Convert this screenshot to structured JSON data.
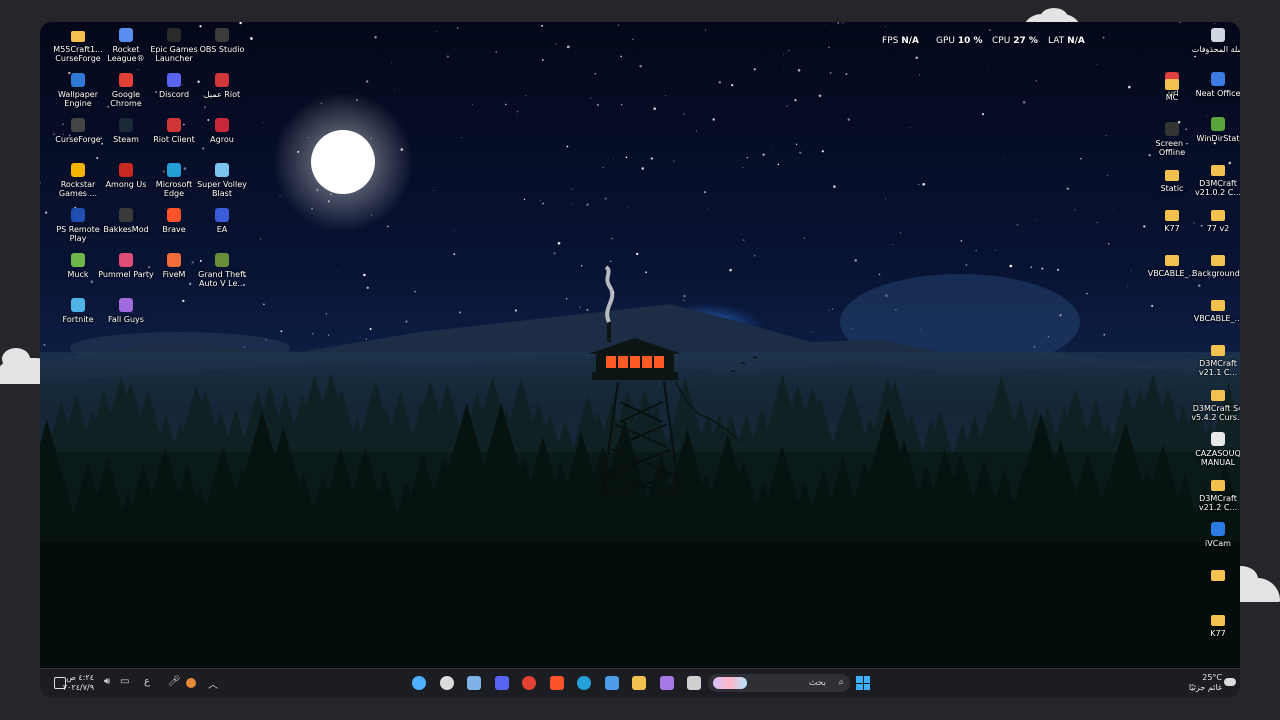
{
  "hud": {
    "fps_label": "FPS",
    "fps_value": "N/A",
    "gpu_label": "GPU",
    "gpu_value": "10 %",
    "cpu_label": "CPU",
    "cpu_value": "27 %",
    "lat_label": "LAT",
    "lat_value": "N/A"
  },
  "desktop": {
    "left_icons": [
      {
        "label": "M55Craft1... CurseForge",
        "icon": "folder-icon",
        "color": "#f2c14e"
      },
      {
        "label": "Rocket League®",
        "icon": "rocket-league-icon",
        "color": "#5b8df0"
      },
      {
        "label": "Epic Games Launcher",
        "icon": "epic-games-icon",
        "color": "#2a2a2a"
      },
      {
        "label": "OBS Studio",
        "icon": "obs-icon",
        "color": "#3b3b3b"
      },
      {
        "label": "Wallpaper Engine",
        "icon": "wallpaper-engine-icon",
        "color": "#2f79d6"
      },
      {
        "label": "Google Chrome",
        "icon": "chrome-icon",
        "color": "#e34133"
      },
      {
        "label": "Discord",
        "icon": "discord-icon",
        "color": "#5865f2"
      },
      {
        "label": "عميل Riot",
        "icon": "riot-icon",
        "color": "#d13639"
      },
      {
        "label": "CurseForge",
        "icon": "curseforge-icon",
        "color": "#444"
      },
      {
        "label": "Steam",
        "icon": "steam-icon",
        "color": "#1b2838"
      },
      {
        "label": "Riot Client",
        "icon": "riot-client-icon",
        "color": "#d13639"
      },
      {
        "label": "Agrou",
        "icon": "agrou-icon",
        "color": "#c8283c"
      },
      {
        "label": "Rockstar Games ...",
        "icon": "rockstar-icon",
        "color": "#f5b400"
      },
      {
        "label": "Among Us",
        "icon": "among-us-icon",
        "color": "#c8281e"
      },
      {
        "label": "Microsoft Edge",
        "icon": "edge-icon",
        "color": "#23a1d6"
      },
      {
        "label": "Super Volley Blast",
        "icon": "super-volley-icon",
        "color": "#7bc4f0"
      },
      {
        "label": "PS Remote Play",
        "icon": "ps-remote-icon",
        "color": "#1f4fb0"
      },
      {
        "label": "BakkesMod",
        "icon": "bakkesmod-icon",
        "color": "#3a3a3a"
      },
      {
        "label": "Brave",
        "icon": "brave-icon",
        "color": "#fb542b"
      },
      {
        "label": "EA",
        "icon": "ea-icon",
        "color": "#3b5bd9"
      },
      {
        "label": "Muck",
        "icon": "muck-icon",
        "color": "#6fb84a"
      },
      {
        "label": "Pummel Party",
        "icon": "pummel-party-icon",
        "color": "#e04d74"
      },
      {
        "label": "FiveM",
        "icon": "fivem-icon",
        "color": "#f26b3a"
      },
      {
        "label": "Grand Theft Auto V Le...",
        "icon": "gta-icon",
        "color": "#6a8f3a"
      },
      {
        "label": "Fortnite",
        "icon": "fortnite-icon",
        "color": "#4fb3e8"
      },
      {
        "label": "Fall Guys",
        "icon": "fall-guys-icon",
        "color": "#a16be0"
      }
    ],
    "right_icons": [
      {
        "label": "سلة المحذوفات",
        "icon": "recycle-bin-icon",
        "color": "#cfd8e0"
      },
      {
        "label": ".url",
        "icon": "url-icon",
        "color": "#e04040"
      },
      {
        "label": "Neat Office",
        "icon": "neat-office-icon",
        "color": "#3c7be0"
      },
      {
        "label": "MC",
        "icon": "folder-icon",
        "color": "#f2c14e"
      },
      {
        "label": "WinDirStat",
        "icon": "windirstat-icon",
        "color": "#5aa43c"
      },
      {
        "label": "Screen - Offline",
        "icon": "screen-icon",
        "color": "#333"
      },
      {
        "label": "D3MCraft v21.0.2 C...",
        "icon": "folder-icon",
        "color": "#f2c14e"
      },
      {
        "label": "Static",
        "icon": "folder-icon",
        "color": "#f2c14e"
      },
      {
        "label": "77 v2",
        "icon": "folder-icon",
        "color": "#f2c14e"
      },
      {
        "label": "K77",
        "icon": "folder-icon",
        "color": "#f2c14e"
      },
      {
        "label": "Backgrounds",
        "icon": "folder-icon",
        "color": "#f2c14e"
      },
      {
        "label": "VBCABLE_...",
        "icon": "folder-icon",
        "color": "#f2c14e"
      },
      {
        "label": "VBCABLE_...",
        "icon": "folder-icon",
        "color": "#f2c14e"
      },
      {
        "label": "D3MCraft v21.1 C...",
        "icon": "folder-icon",
        "color": "#f2c14e"
      },
      {
        "label": "D3MCraft S4 v5.4.2 Curs...",
        "icon": "folder-icon",
        "color": "#f2c14e"
      },
      {
        "label": "CAZASOUQ MANUAL",
        "icon": "document-icon",
        "color": "#e8e8e8"
      },
      {
        "label": "D3MCraft v21.2 C...",
        "icon": "folder-icon",
        "color": "#f2c14e"
      },
      {
        "label": "iVCam",
        "icon": "ivcam-icon",
        "color": "#2c7be5"
      },
      {
        "label": "",
        "icon": "folder-icon",
        "color": "#f2c14e"
      },
      {
        "label": "K77",
        "icon": "folder-icon",
        "color": "#f2c14e"
      }
    ]
  },
  "taskbar": {
    "clock_time": "٤:٢٤ ص",
    "clock_date": "٢٠٢٤/٧/٩",
    "language": "ع",
    "search_placeholder": "بحث",
    "weather_temp": "25°C",
    "weather_desc": "غائم جزئيًا",
    "pinned": [
      {
        "icon": "widgets-icon",
        "color": "#4fb0ff"
      },
      {
        "icon": "obs-icon",
        "color": "#dcdcdc"
      },
      {
        "icon": "steam-icon",
        "color": "#7fb2e6"
      },
      {
        "icon": "discord-icon",
        "color": "#5865f2"
      },
      {
        "icon": "chrome-icon",
        "color": "#e34133"
      },
      {
        "icon": "brave-icon",
        "color": "#fb542b"
      },
      {
        "icon": "edge-icon",
        "color": "#23a1d6"
      },
      {
        "icon": "store-icon",
        "color": "#4c9be8"
      },
      {
        "icon": "file-explorer-icon",
        "color": "#f2c14e"
      },
      {
        "icon": "copilot-icon",
        "color": "#a678e8"
      },
      {
        "icon": "task-view-icon",
        "color": "#cfcfcf"
      }
    ]
  },
  "colors": {
    "sky_top": "#04081a",
    "forest": "#061210",
    "moon": "#ffffff",
    "tower_light": "#ff5a24",
    "taskbar": "#1b1d22"
  }
}
